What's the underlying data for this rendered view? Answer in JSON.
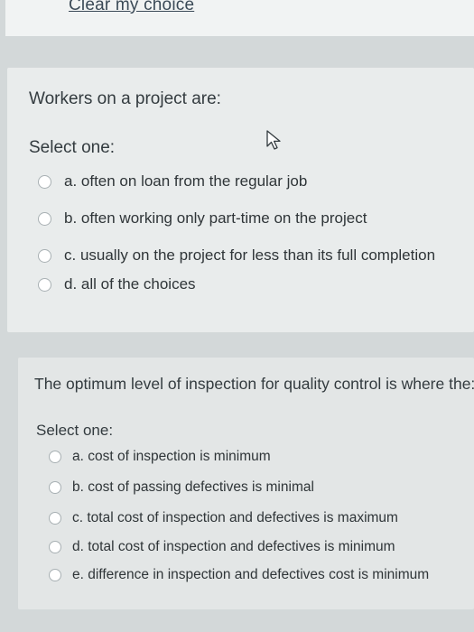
{
  "top": {
    "clear_label": "Clear my choice"
  },
  "question1": {
    "text": "Workers on a project are:",
    "select_label": "Select one:",
    "options": [
      "a. often on loan from the regular job",
      "b. often working only part-time on the project",
      "c. usually on the project for less than its full completion",
      "d. all of the choices"
    ]
  },
  "question2": {
    "text": "The optimum level of inspection for quality control is where the:",
    "select_label": "Select one:",
    "options": [
      "a. cost of inspection is minimum",
      "b. cost of passing defectives is minimal",
      "c. total cost of inspection and defectives is maximum",
      "d. total cost of inspection and defectives is minimum",
      "e. difference in inspection and defectives cost is minimum"
    ]
  },
  "colors": {
    "page_background": "#d3d8d9",
    "card_background": "#e9ecec",
    "text": "#2d3436",
    "radio_border": "#a8b0b3"
  },
  "icons": {
    "cursor": "mouse-pointer-icon"
  }
}
